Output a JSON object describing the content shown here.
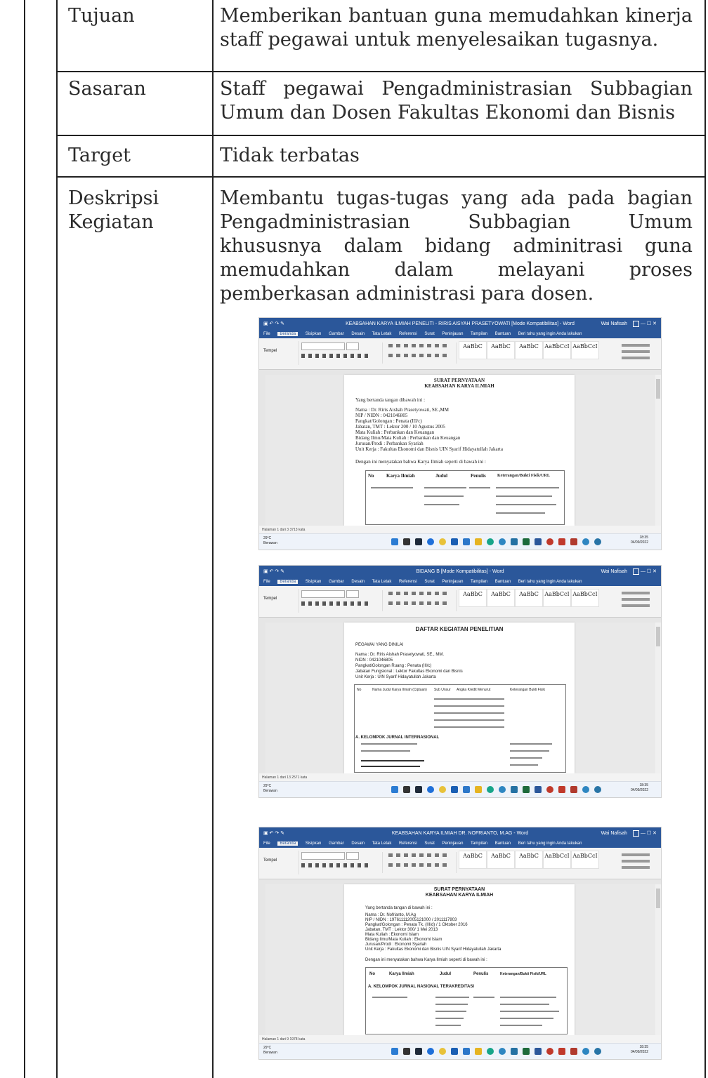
{
  "table": {
    "rows": [
      {
        "label": "Tujuan",
        "content": "Memberikan bantuan guna memudahkan kinerja staff pegawai untuk menyelesaikan tugasnya."
      },
      {
        "label": "Sasaran",
        "content": "Staff pegawai Pengadministrasian Subbagian Umum dan Dosen Fakultas Ekonomi dan Bisnis"
      },
      {
        "label": "Target",
        "content": "Tidak terbatas"
      },
      {
        "label_line1": "Deskripsi",
        "label_line2": "Kegiatan",
        "content": "Membantu tugas-tugas yang ada pada bagian Pengadministrasian Subbagian Umum khususnya dalam bidang adminitrasi guna memudahkan dalam melayani proses pemberkasan administrasi para dosen."
      }
    ]
  },
  "screenshots": [
    {
      "window_title": "KEABSAHAN KARYA ILMIAH PENELITI - RIRIS AISYAH PRASETYOWATI [Mode Kompatibilitas] - Word",
      "user": "Wai Nafisah",
      "active_tab": "Beranda",
      "doc_title_line1": "SURAT PERNYATAAN",
      "doc_title_line2": "KEABSAHAN KARYA ILMIAH",
      "intro": "Yang bertanda tangan dibawah ini :",
      "fields": [
        "Nama : Dr. Riris Aishah Prasetyowati, SE.,MM",
        "NIP / NIDN : 0421046805",
        "Pangkat/Golongan : Penata (III/c)",
        "Jabatan, TMT : Lektor 200 / 10 Agustus 2005",
        "Mata Kuliah : Perbankan dan Keuangan",
        "Bidang Ilmu/Mata Kuliah : Perbankan dan Keuangan",
        "Jurusan/Prodi : Perbankan Syariah",
        "Unit Kerja : Fakultas Ekonomi dan Bisnis UIN Syarif Hidayatullah Jakarta"
      ],
      "statement": "Dengan ini menyatakan bahwa Karya Ilmiah seperti di bawah ini :",
      "table_headers": [
        "No",
        "Karya Ilmiah",
        "Judul",
        "Penulis",
        "Keterangan/Bukti Fisik/URL"
      ],
      "status": "Halaman 1 dari 3    3713 kata",
      "weather": "29°C Berawan",
      "time": "18:35",
      "date": "04/09/2022"
    },
    {
      "window_title": "BIDANG B [Mode Kompatibilitas] - Word",
      "user": "Wai Nafisah",
      "active_tab": "Beranda",
      "doc_title_line1": "DAFTAR KEGIATAN PENELITIAN",
      "intro": "PEGAWAI YANG DINILAI",
      "fields": [
        "Nama : Dr. Riris Aishah Prasetyowati, SE., MM.",
        "NIDN : 0421046805",
        "Pangkat/Golongan Ruang : Penata (III/c)",
        "Jabatan Fungsional : Lektor Fakultas Ekonomi dan Bisnis",
        "Unit Kerja : UIN Syarif Hidayatullah Jakarta"
      ],
      "table_headers": [
        "No",
        "Nama Judul Karya Ilmiah (Ciptaan)",
        "Sub Unsur",
        "Angka Kredit Menurut",
        "Keterangan Bukti Fisik"
      ],
      "section": "A. KELOMPOK JURNAL INTERNASIONAL",
      "status": "Halaman 1 dari 13    2571 kata",
      "weather": "29°C Berawan",
      "time": "18:35",
      "date": "04/09/2022"
    },
    {
      "window_title": "KEABSAHAN KARYA ILMIAH DR. NOFRIANTO, M.AG - Word",
      "user": "Wai Nafisah",
      "active_tab": "Beranda",
      "doc_title_line1": "SURAT PERNYATAAN",
      "doc_title_line2": "KEABSAHAN KARYA ILMIAH",
      "intro": "Yang bertanda tangan di bawah ini :",
      "fields": [
        "Nama : Dr. Nofrianto, M.Ag",
        "NIP / NIDN : 197611112005121000 / 2011117803",
        "Pangkat/Golongan : Penata Tk. (III/d) / 1 Oktober 2016",
        "Jabatan, TMT : Lektor 300/ 1 Mei 2013",
        "Mata Kuliah : Ekonomi Islam",
        "Bidang Ilmu/Mata Kuliah : Ekonomi Islam",
        "Jurusan/Prodi : Ekonomi Syariah",
        "Unit Kerja : Fakultas Ekonomi dan Bisnis UIN Syarif Hidayatullah Jakarta"
      ],
      "statement": "Dengan ini menyatakan bahwa Karya Ilmiah seperti di bawah ini :",
      "table_headers": [
        "No",
        "Karya Ilmiah",
        "Judul",
        "Penulis",
        "Keterangan/Bukti Fisik/URL"
      ],
      "section": "A. KELOMPOK JURNAL NASIONAL TERAKREDITASI",
      "status": "Halaman 1 dari 9    1978 kata",
      "weather": "29°C Berawan",
      "time": "18:35",
      "date": "04/09/2022"
    }
  ],
  "common": {
    "menu_tabs": [
      "File",
      "Beranda",
      "Sisipkan",
      "Gambar",
      "Desain",
      "Tata Letak",
      "Referensi",
      "Surat",
      "Peninjauan",
      "Tampilan",
      "Bantuan"
    ],
    "tell_me": "Beri tahu yang ingin Anda lakukan",
    "share": "Bagikan",
    "clipboard": "Tempel",
    "style_samples": [
      "AaBbC",
      "AaBbC",
      "AaBbC",
      "AaBbCcI",
      "AaBbCcI"
    ]
  },
  "colors": {
    "word_blue": "#2b579a",
    "text": "#2b2b2b"
  }
}
